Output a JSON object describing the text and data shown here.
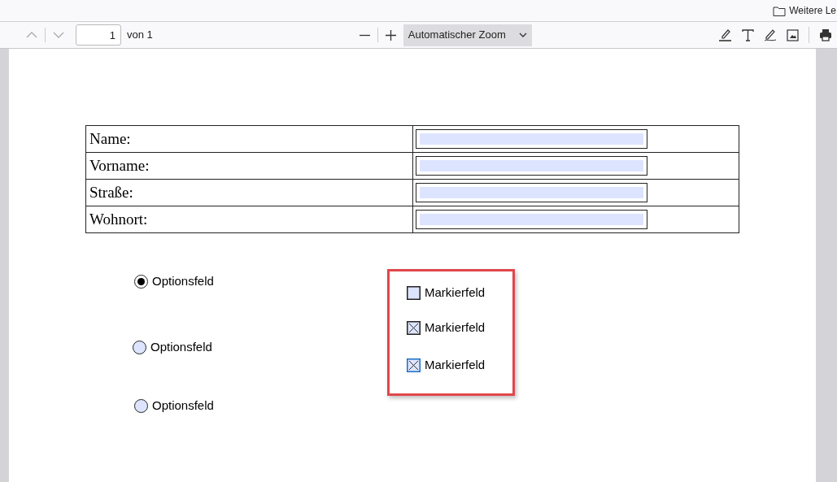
{
  "top_bar": {
    "folder_label": "Weitere Le"
  },
  "toolbar": {
    "page_number": "1",
    "page_count": "von 1",
    "zoom": "Automatischer Zoom"
  },
  "form_table": {
    "rows": [
      {
        "label": "Name:",
        "value": ""
      },
      {
        "label": "Vorname:",
        "value": ""
      },
      {
        "label": "Straße:",
        "value": ""
      },
      {
        "label": "Wohnort:",
        "value": ""
      }
    ]
  },
  "radio_buttons": [
    {
      "label": "Optionsfeld",
      "selected": true
    },
    {
      "label": "Optionsfeld",
      "selected": false
    },
    {
      "label": "Optionsfeld",
      "selected": false
    }
  ],
  "checkboxes": [
    {
      "label": "Markierfeld",
      "checked": false,
      "focused": false
    },
    {
      "label": "Markierfeld",
      "checked": true,
      "focused": false
    },
    {
      "label": "Markierfeld",
      "checked": true,
      "focused": true
    }
  ]
}
